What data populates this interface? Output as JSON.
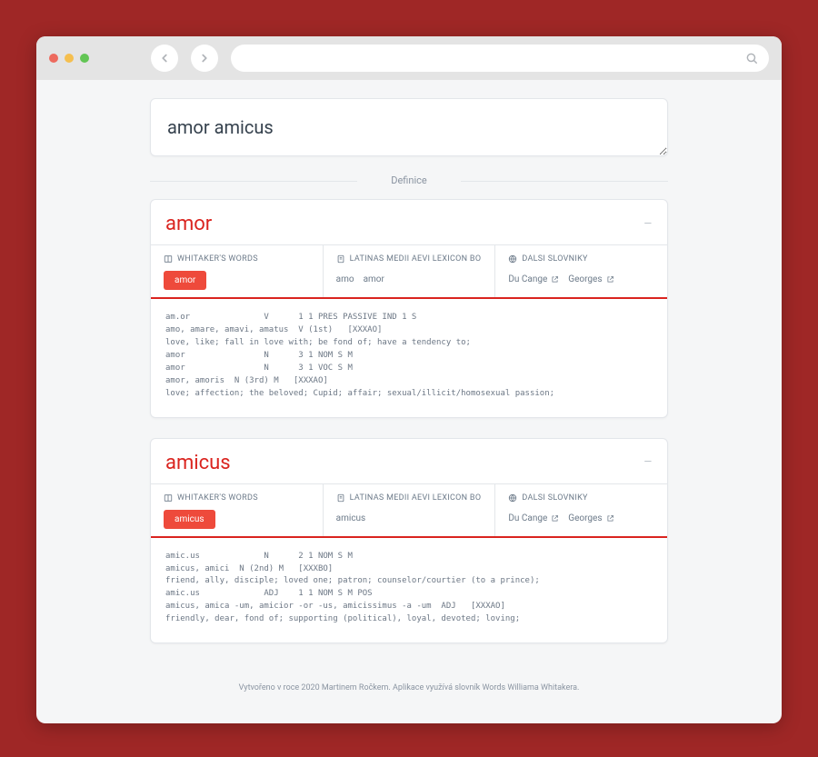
{
  "browser": {
    "url": "",
    "search_icon": "search-icon"
  },
  "app": {
    "query": "amor amicus",
    "divider_label": "Definice",
    "footer": "Vytvořeno v roce 2020 Martinem Ročkem. Aplikace využívá slovník Words Williama Whitakera."
  },
  "sources": {
    "whitakers_label": "WHITAKER'S WORDS",
    "latinas_label": "LATINAS MEDII AEVI LEXICON BOHEMORUM",
    "other_label": "DALŠÍ SLOVNÍKY",
    "du_cange": "Du Cange",
    "georges": "Georges"
  },
  "entries": [
    {
      "term": "amor",
      "whitakers_chips": [
        "amor"
      ],
      "latinas_chips": [
        "amo",
        "amor"
      ],
      "definition": "am.or               V      1 1 PRES PASSIVE IND 1 S\namo, amare, amavi, amatus  V (1st)   [XXXAO]\nlove, like; fall in love with; be fond of; have a tendency to;\namor                N      3 1 NOM S M\namor                N      3 1 VOC S M\namor, amoris  N (3rd) M   [XXXAO]\nlove; affection; the beloved; Cupid; affair; sexual/illicit/homosexual passion;"
    },
    {
      "term": "amicus",
      "whitakers_chips": [
        "amicus"
      ],
      "latinas_chips": [
        "amicus"
      ],
      "definition": "amic.us             N      2 1 NOM S M\namicus, amici  N (2nd) M   [XXXBO]\nfriend, ally, disciple; loved one; patron; counselor/courtier (to a prince);\namic.us             ADJ    1 1 NOM S M POS\namicus, amica -um, amicior -or -us, amicissimus -a -um  ADJ   [XXXAO]\nfriendly, dear, fond of; supporting (political), loyal, devoted; loving;"
    }
  ]
}
